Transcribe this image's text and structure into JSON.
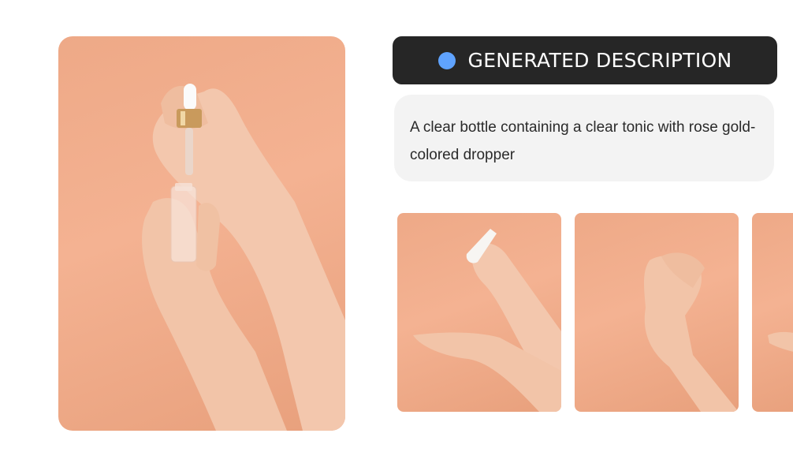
{
  "header": {
    "title": "GENERATED DESCRIPTION",
    "accent_color": "#5fa3ff",
    "background": "#262626"
  },
  "description": {
    "text": "A clear bottle containing a clear tonic with rose gold-colored dropper"
  },
  "images": {
    "main": {
      "icon": "photo-hands-dropper-bottle",
      "background": "#f0ab88"
    },
    "thumbnails": [
      {
        "icon": "photo-hands-cream-tube"
      },
      {
        "icon": "photo-hands-clasped"
      },
      {
        "icon": "photo-hand-partial"
      }
    ]
  }
}
